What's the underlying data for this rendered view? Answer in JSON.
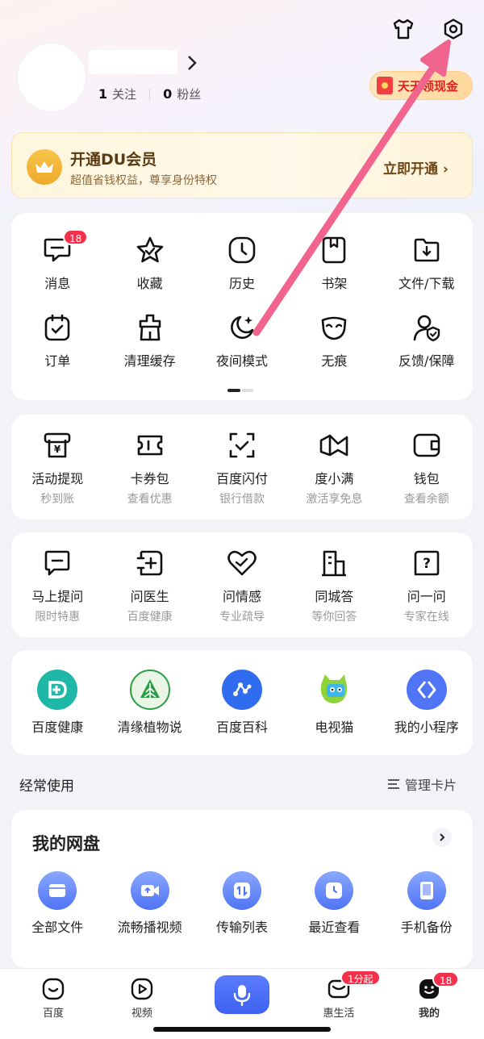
{
  "header": {
    "follow_count": "1",
    "follow_label": "关注",
    "fans_count": "0",
    "fans_label": "粉丝",
    "cash_label": "天天领现金"
  },
  "vip": {
    "title": "开通DU会员",
    "subtitle": "超值省钱权益，尊享身份特权",
    "action": "立即开通 ›"
  },
  "quick_tools": {
    "row1": [
      {
        "label": "消息",
        "badge": "18"
      },
      {
        "label": "收藏"
      },
      {
        "label": "历史"
      },
      {
        "label": "书架"
      },
      {
        "label": "文件/下载"
      }
    ],
    "row2": [
      {
        "label": "订单"
      },
      {
        "label": "清理缓存"
      },
      {
        "label": "夜间模式"
      },
      {
        "label": "无痕"
      },
      {
        "label": "反馈/保障"
      }
    ]
  },
  "finance": [
    {
      "label": "活动提现",
      "sub": "秒到账"
    },
    {
      "label": "卡券包",
      "sub": "查看优惠"
    },
    {
      "label": "百度闪付",
      "sub": "银行借款"
    },
    {
      "label": "度小满",
      "sub": "激活享免息"
    },
    {
      "label": "钱包",
      "sub": "查看余额"
    }
  ],
  "ask": [
    {
      "label": "马上提问",
      "sub": "限时特惠"
    },
    {
      "label": "问医生",
      "sub": "百度健康"
    },
    {
      "label": "问情感",
      "sub": "专业疏导"
    },
    {
      "label": "同城答",
      "sub": "等你回答"
    },
    {
      "label": "问一问",
      "sub": "专家在线"
    }
  ],
  "apps": [
    {
      "label": "百度健康"
    },
    {
      "label": "清缘植物说"
    },
    {
      "label": "百度百科"
    },
    {
      "label": "电视猫"
    },
    {
      "label": "我的小程序"
    }
  ],
  "frequent": {
    "title": "经常使用",
    "manage": "管理卡片"
  },
  "netdisk": {
    "title": "我的网盘",
    "items": [
      {
        "label": "全部文件"
      },
      {
        "label": "流畅播视频"
      },
      {
        "label": "传输列表"
      },
      {
        "label": "最近查看"
      },
      {
        "label": "手机备份"
      }
    ]
  },
  "tabbar": {
    "tabs": [
      {
        "label": "百度"
      },
      {
        "label": "视频"
      },
      {
        "label": "惠生活",
        "badge": "1分起"
      },
      {
        "label": "我的",
        "badge": "18"
      }
    ]
  },
  "colors": {
    "accent_blue": "#4f74f5",
    "badge_red": "#f5304a",
    "arrow_pink": "#f0648e",
    "vip_gold": "#eeaa2a"
  }
}
